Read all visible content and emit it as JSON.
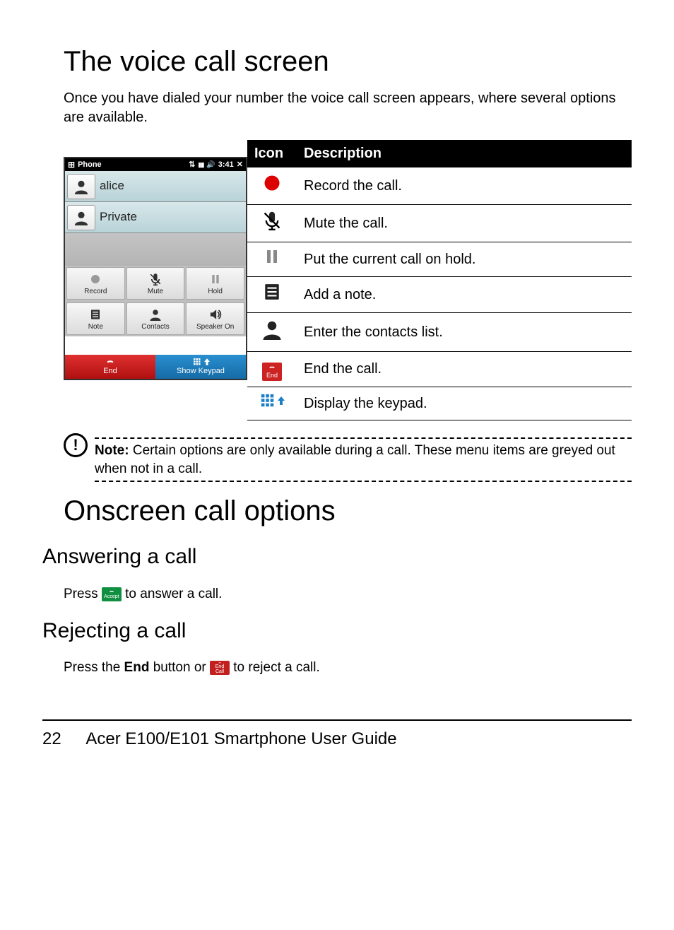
{
  "heading1": "The voice call screen",
  "intro": "Once you have dialed your number the voice call screen appears, where several options are available.",
  "phone": {
    "status_title": "Phone",
    "status_time": "3:41",
    "call1": "alice",
    "call2": "Private",
    "btns": {
      "record": "Record",
      "mute": "Mute",
      "hold": "Hold",
      "note": "Note",
      "contacts": "Contacts",
      "speaker": "Speaker On"
    },
    "end": "End",
    "show_keypad": "Show Keypad"
  },
  "table": {
    "h_icon": "Icon",
    "h_desc": "Description",
    "rows": [
      {
        "desc": "Record the call."
      },
      {
        "desc": "Mute the call."
      },
      {
        "desc": "Put the current call on hold."
      },
      {
        "desc": "Add a note."
      },
      {
        "desc": "Enter the contacts list."
      },
      {
        "desc": "End the call."
      },
      {
        "desc": "Display the keypad."
      }
    ],
    "end_label": "End"
  },
  "note": {
    "label": "Note:",
    "body": " Certain options are only available during a call. These menu items are greyed out when not in a call."
  },
  "heading2": "Onscreen call options",
  "answering": {
    "title": "Answering a call",
    "pre": "Press ",
    "badge": "Accept",
    "post": " to answer a call."
  },
  "rejecting": {
    "title": "Rejecting a call",
    "pre": "Press the ",
    "end_word": "End",
    "mid": " button or ",
    "badge": "End Call",
    "post": " to reject a call."
  },
  "footer": {
    "page": "22",
    "title": "Acer E100/E101 Smartphone User Guide"
  }
}
